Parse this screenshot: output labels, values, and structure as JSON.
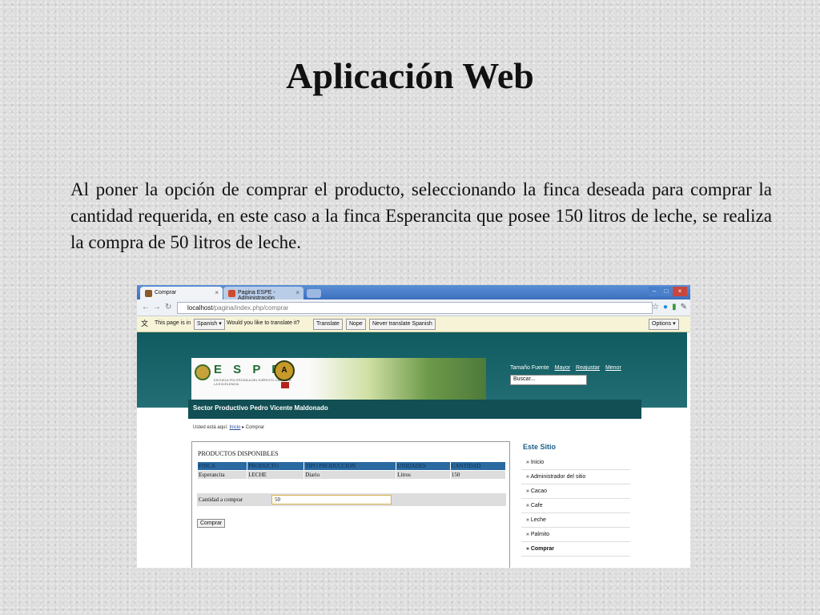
{
  "slide": {
    "title": "Aplicación Web",
    "body": "Al poner la opción de comprar el producto, seleccionando la finca deseada para comprar la cantidad requerida, en este caso a la finca Esperancita que posee 150 litros de leche, se realiza la compra de 50 litros de leche."
  },
  "browser": {
    "tabs": [
      {
        "label": "Comprar",
        "icon": "page-icon"
      },
      {
        "label": "Pagina ESPE - Administración",
        "icon": "admin-page-icon"
      }
    ],
    "url_host": "localhost",
    "url_path": "/pagina/index.php/comprar",
    "translate_bar": {
      "prefix": "This page is in",
      "language": "Spanish",
      "question": "Would you like to translate it?",
      "translate_btn": "Translate",
      "nope_btn": "Nope",
      "never_btn": "Never translate Spanish",
      "options_btn": "Options"
    }
  },
  "site": {
    "logo_text": "E S P E",
    "logo_sub": "ESCUELA POLITÉCNICA DEL EJÉRCITO CAMINO A LA EXCELENCIA",
    "badge": "A",
    "sector": "Sector Productivo Pedro Vicente Maldonado",
    "font_label": "Tamaño Fuente",
    "font_bigger": "Mayor",
    "font_reset": "Reajustar",
    "font_smaller": "Menor",
    "search_value": "Buscar...",
    "breadcrumb_prefix": "Usted está aquí:",
    "breadcrumb_home": "Inicio",
    "breadcrumb_sep": "▸",
    "breadcrumb_current": "Comprar",
    "products_title": "PRODUCTOS DISPONIBLES",
    "table": {
      "headers": [
        "FINCA",
        "PRODUCTO",
        "TIPO PRODUCCION",
        "UNIDADES",
        "CANTIDAD"
      ],
      "row": [
        "Esperancita",
        "LECHE",
        "Diario",
        "Litros",
        "150"
      ]
    },
    "qty_label": "Cantidad a comprar",
    "qty_value": "50",
    "buy_button": "Comprar",
    "sidebar_title": "Este Sitio",
    "sidebar_items": [
      "Inicio",
      "Administrador del sitio",
      "Cacao",
      "Cafe",
      "Leche",
      "Palmito",
      "Comprar"
    ]
  }
}
